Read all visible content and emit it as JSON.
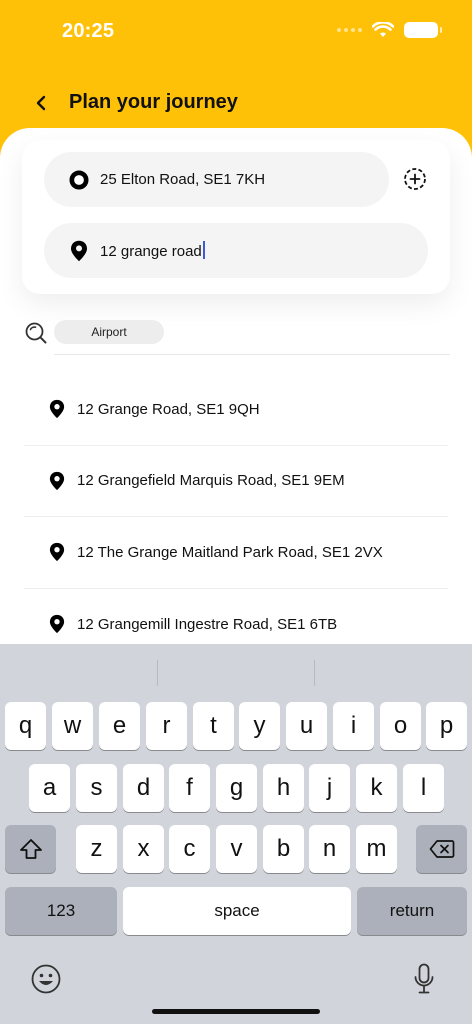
{
  "status_bar": {
    "time": "20:25"
  },
  "header": {
    "title": "Plan your journey"
  },
  "colors": {
    "header": "#FFC107",
    "caret": "#3B5BDB",
    "keyboard": "#D1D4DA"
  },
  "journey": {
    "origin": {
      "value": "25 Elton Road, SE1 7KH",
      "icon": "origin-circle-icon"
    },
    "destination": {
      "value": "12 grange road",
      "icon": "map-pin-icon"
    },
    "add_stop_icon": "add-stop-icon"
  },
  "quick_filters": {
    "search_icon": "search-icon",
    "chip": "Airport"
  },
  "results": [
    {
      "label": "12 Grange Road, SE1 9QH"
    },
    {
      "label": "12 Grangefield Marquis Road, SE1 9EM"
    },
    {
      "label": "12 The Grange Maitland Park Road, SE1 2VX"
    },
    {
      "label": "12 Grangemill Ingestre Road, SE1 6TB"
    }
  ],
  "keyboard": {
    "row1": [
      "q",
      "w",
      "e",
      "r",
      "t",
      "y",
      "u",
      "i",
      "o",
      "p"
    ],
    "row2": [
      "a",
      "s",
      "d",
      "f",
      "g",
      "h",
      "j",
      "k",
      "l"
    ],
    "row3": [
      "z",
      "x",
      "c",
      "v",
      "b",
      "n",
      "m"
    ],
    "numbers_key": "123",
    "space_key": "space",
    "return_key": "return"
  }
}
